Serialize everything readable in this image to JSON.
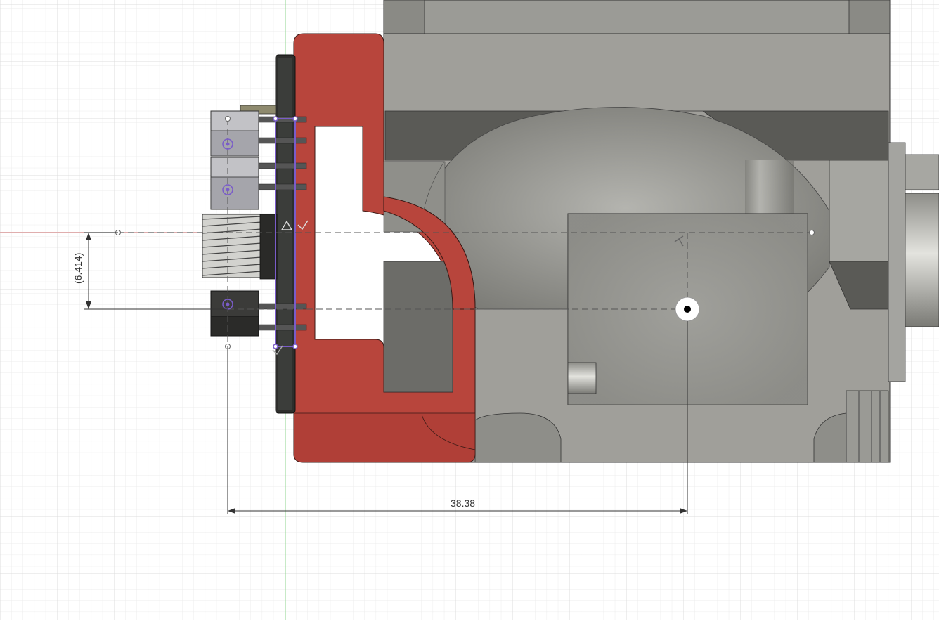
{
  "viewport": {
    "background": "#ffffff",
    "grid_minor_color": "#ececec",
    "grid_major_color": "#dcdcdc",
    "origin_x_axis_color": "#e58080",
    "origin_y_axis_color": "#8fd68f"
  },
  "model": {
    "body_color": "#9c9c97",
    "body_dark_color": "#5e5e5a",
    "housing_color": "#b8453c",
    "sketch_color": "#7a5cc9"
  },
  "dimensions": {
    "vertical_label": "(6.414)",
    "horizontal_label": "38.38"
  },
  "icons": {
    "point": "sketch-point-icon",
    "origin": "origin-icon",
    "constraint_triangle": "triangle-constraint-icon",
    "constraint_check": "check-constraint-icon"
  }
}
